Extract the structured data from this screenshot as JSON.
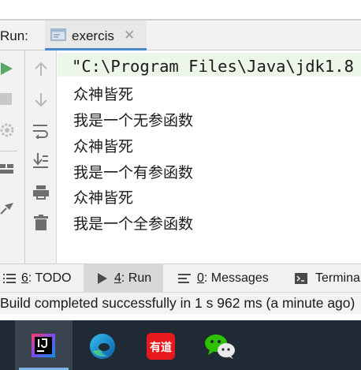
{
  "run_panel": {
    "label": "Run:",
    "tab_label": "exercis",
    "tab_close": "✕"
  },
  "console": {
    "command": "\"C:\\Program Files\\Java\\jdk1.8",
    "lines": [
      "众神皆死",
      "我是一个无参函数",
      "众神皆死",
      "我是一个有参函数",
      "众神皆死",
      "我是一个全参函数"
    ]
  },
  "tool_tabs": [
    {
      "mnemonic": "6",
      "label": ": TODO"
    },
    {
      "mnemonic": "4",
      "label": ": Run"
    },
    {
      "mnemonic": "0",
      "label": ": Messages"
    },
    {
      "label": "Terminal"
    }
  ],
  "status_bar": {
    "text": "Build completed successfully in 1 s 962 ms (a minute ago)"
  },
  "taskbar": {
    "apps": [
      "intellij-idea",
      "microsoft-edge",
      "youdao-dictionary",
      "wechat"
    ],
    "youdao_text": "有道"
  },
  "colors": {
    "tab_underline": "#4a88c7",
    "run_green": "#59a869",
    "command_line_bg": "#edf7e9",
    "taskbar_bg": "#1f2a35",
    "youdao_red": "#e8191d",
    "wechat_green": "#2dc100"
  }
}
